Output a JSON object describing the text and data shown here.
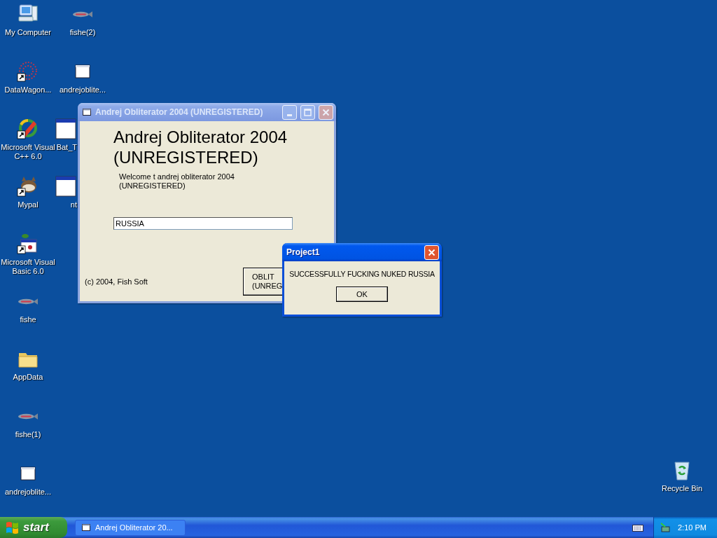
{
  "desktop": {
    "columns": [
      [
        {
          "label": "My Computer",
          "kind": "computer",
          "shortcut": false
        },
        {
          "label": "DataWagon...",
          "kind": "dots",
          "shortcut": true
        },
        {
          "label": "Microsoft Visual C++ 6.0",
          "kind": "cpp",
          "shortcut": true
        },
        {
          "label": "Mypal",
          "kind": "animal",
          "shortcut": true
        },
        {
          "label": "Microsoft Visual Basic 6.0",
          "kind": "basic",
          "shortcut": true
        },
        {
          "label": "fishe",
          "kind": "fish",
          "shortcut": false
        },
        {
          "label": "AppData",
          "kind": "folder",
          "shortcut": false
        },
        {
          "label": "fishe(1)",
          "kind": "fish",
          "shortcut": false
        },
        {
          "label": "andrejoblite...",
          "kind": "file",
          "shortcut": false
        }
      ],
      [
        {
          "label": "fishe(2)",
          "kind": "fish",
          "shortcut": false
        },
        {
          "label": "andrejoblite...",
          "kind": "file",
          "shortcut": false
        },
        {
          "label": "Bat_T",
          "kind": "program",
          "shortcut": false
        },
        {
          "label": "nt",
          "kind": "program",
          "shortcut": false
        }
      ]
    ],
    "recycle_bin": {
      "label": "Recycle Bin"
    }
  },
  "app_window": {
    "title": "Andrej Obliterator 2004 (UNREGISTERED)",
    "active": false,
    "heading": "Andrej Obliterator 2004\n(UNREGISTERED)",
    "welcome": "Welcome t andrej obliterator 2004\n(UNREGISTERED)",
    "field_value": "RUSSIA",
    "copyright": "(c) 2004, Fish Soft",
    "button": "OBLIT\n(UNREG"
  },
  "dialog": {
    "title": "Project1",
    "active": true,
    "message": "SUCCESSFULLY FUCKING NUKED RUSSIA",
    "button": "OK"
  },
  "taskbar": {
    "start": "start",
    "tasks": [
      {
        "label": "Andrej Obliterator 20...",
        "selected": false
      }
    ],
    "clock": "2:10 PM"
  }
}
